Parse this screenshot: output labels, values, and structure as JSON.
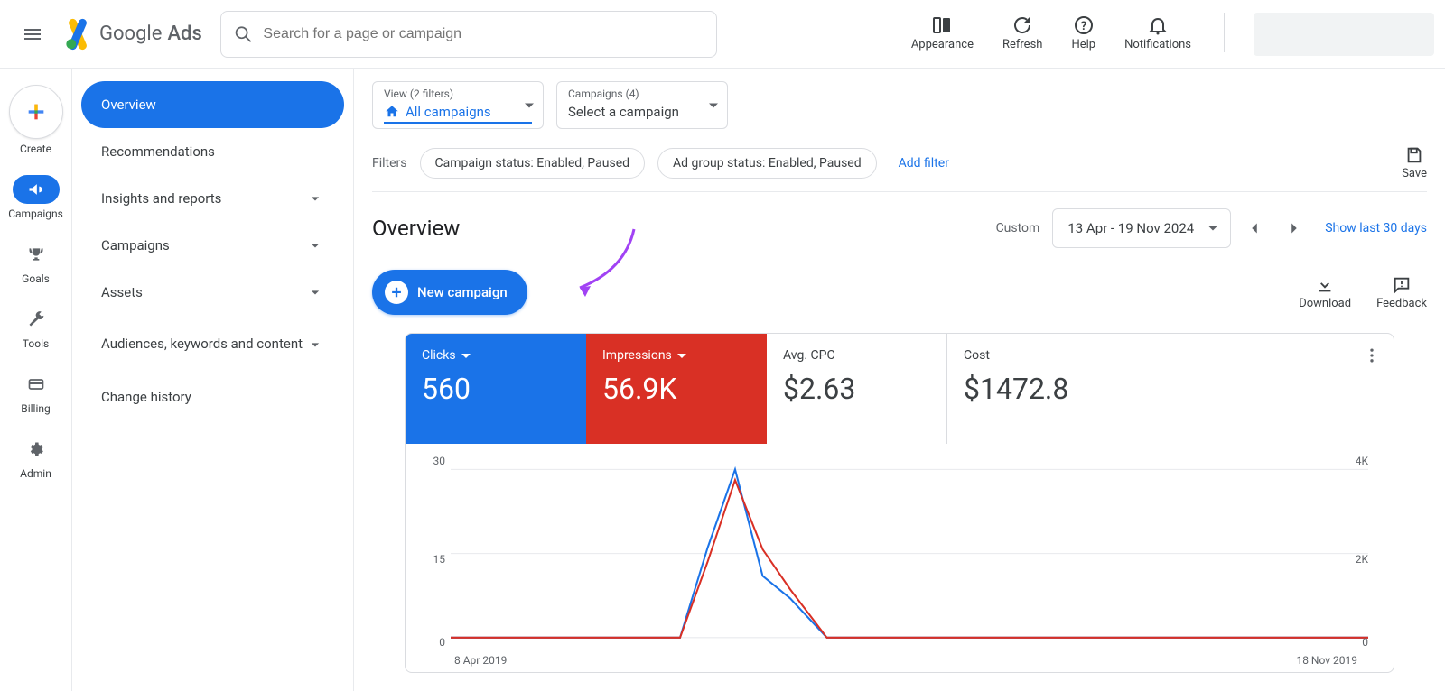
{
  "top": {
    "logo_text_1": "Google",
    "logo_text_2": "Ads",
    "search_placeholder": "Search for a page or campaign",
    "actions": {
      "appearance": "Appearance",
      "refresh": "Refresh",
      "help": "Help",
      "notifications": "Notifications"
    }
  },
  "rail": {
    "create": "Create",
    "campaigns": "Campaigns",
    "goals": "Goals",
    "tools": "Tools",
    "billing": "Billing",
    "admin": "Admin"
  },
  "sidenav": {
    "overview": "Overview",
    "recommendations": "Recommendations",
    "insights": "Insights and reports",
    "campaigns": "Campaigns",
    "assets": "Assets",
    "audiences": "Audiences, keywords and content",
    "change_history": "Change history"
  },
  "selectors": {
    "view_label": "View (2 filters)",
    "view_value": "All campaigns",
    "campaigns_label": "Campaigns (4)",
    "campaigns_value": "Select a campaign"
  },
  "filters": {
    "label": "Filters",
    "chip_campaign_status": "Campaign status: Enabled, Paused",
    "chip_adgroup_status": "Ad group status: Enabled, Paused",
    "add_filter": "Add filter",
    "save": "Save"
  },
  "page": {
    "title": "Overview",
    "custom_label": "Custom",
    "date_range": "13 Apr - 19 Nov 2024",
    "show_last_30": "Show last 30 days"
  },
  "buttons": {
    "new_campaign": "New campaign",
    "download": "Download",
    "feedback": "Feedback"
  },
  "metrics": {
    "clicks_label": "Clicks",
    "clicks_value": "560",
    "impressions_label": "Impressions",
    "impressions_value": "56.9K",
    "avg_cpc_label": "Avg. CPC",
    "avg_cpc_value": "$2.63",
    "cost_label": "Cost",
    "cost_value": "$1472.8"
  },
  "chart_data": {
    "type": "line",
    "x_start_label": "8 Apr 2019",
    "x_end_label": "18 Nov 2019",
    "y_left": {
      "ticks": [
        "30",
        "15",
        "0"
      ],
      "max": 30,
      "label": ""
    },
    "y_right": {
      "ticks": [
        "4K",
        "2K",
        "0"
      ],
      "max": 4000,
      "label": ""
    },
    "series": [
      {
        "name": "Clicks",
        "color": "#1a73e8",
        "axis": "left",
        "x_norm": [
          0.0,
          0.25,
          0.28,
          0.31,
          0.34,
          0.37,
          0.41,
          1.0
        ],
        "y": [
          0,
          0,
          16,
          30,
          11,
          7,
          0,
          0
        ]
      },
      {
        "name": "Impressions",
        "color": "#d93025",
        "axis": "right",
        "x_norm": [
          0.0,
          0.25,
          0.28,
          0.31,
          0.34,
          0.37,
          0.41,
          1.0
        ],
        "y": [
          0,
          0,
          1800,
          3750,
          2100,
          1150,
          0,
          0
        ]
      }
    ]
  }
}
